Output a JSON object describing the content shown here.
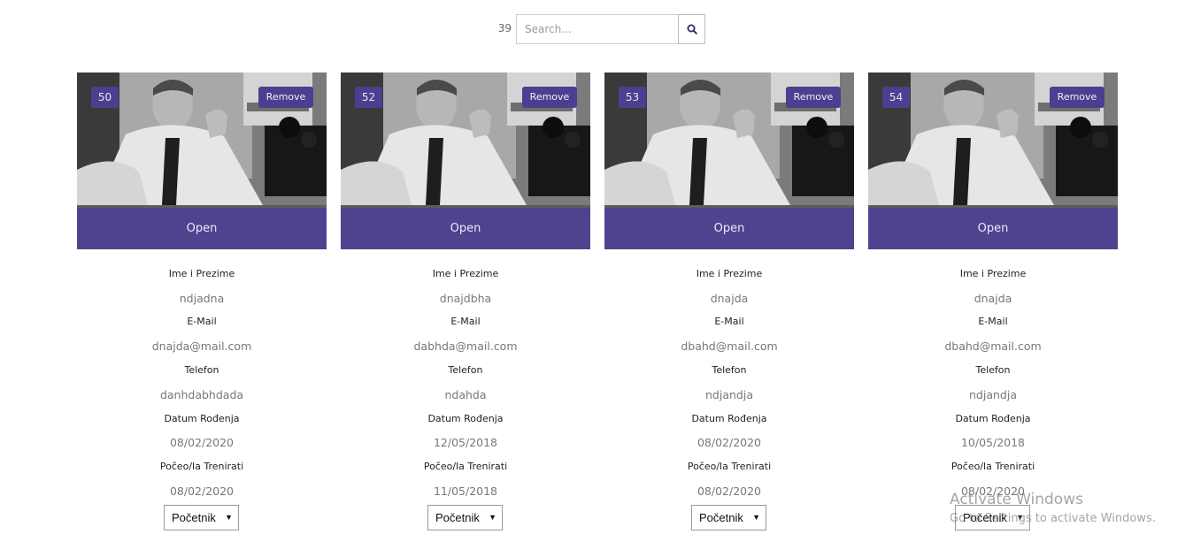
{
  "search": {
    "count": "39",
    "placeholder": "Search...",
    "icon": "search-icon"
  },
  "labels": {
    "name": "Ime i Prezime",
    "email": "E-Mail",
    "phone": "Telefon",
    "birth": "Datum Rođenja",
    "started": "Počeo/la Trenirati"
  },
  "photo_overlay": {
    "remove": "Remove",
    "open": "Open"
  },
  "cards": [
    {
      "id": "50",
      "name": "ndjadna",
      "email": "dnajda@mail.com",
      "phone": "danhdabhdada",
      "birth": "08/02/2020",
      "started": "08/02/2020",
      "level": "Početnik"
    },
    {
      "id": "52",
      "name": "dnajdbha",
      "email": "dabhda@mail.com",
      "phone": "ndahda",
      "birth": "12/05/2018",
      "started": "11/05/2018",
      "level": "Početnik"
    },
    {
      "id": "53",
      "name": "dnajda",
      "email": "dbahd@mail.com",
      "phone": "ndjandja",
      "birth": "08/02/2020",
      "started": "08/02/2020",
      "level": "Početnik"
    },
    {
      "id": "54",
      "name": "dnajda",
      "email": "dbahd@mail.com",
      "phone": "ndjandja",
      "birth": "10/05/2018",
      "started": "08/02/2020",
      "level": "Početnik"
    }
  ],
  "watermark": {
    "title": "Activate Windows",
    "subtitle": "Go to Settings to activate Windows."
  },
  "colors": {
    "accent": "#4c3f8f",
    "overlay": "#4d3f98"
  }
}
